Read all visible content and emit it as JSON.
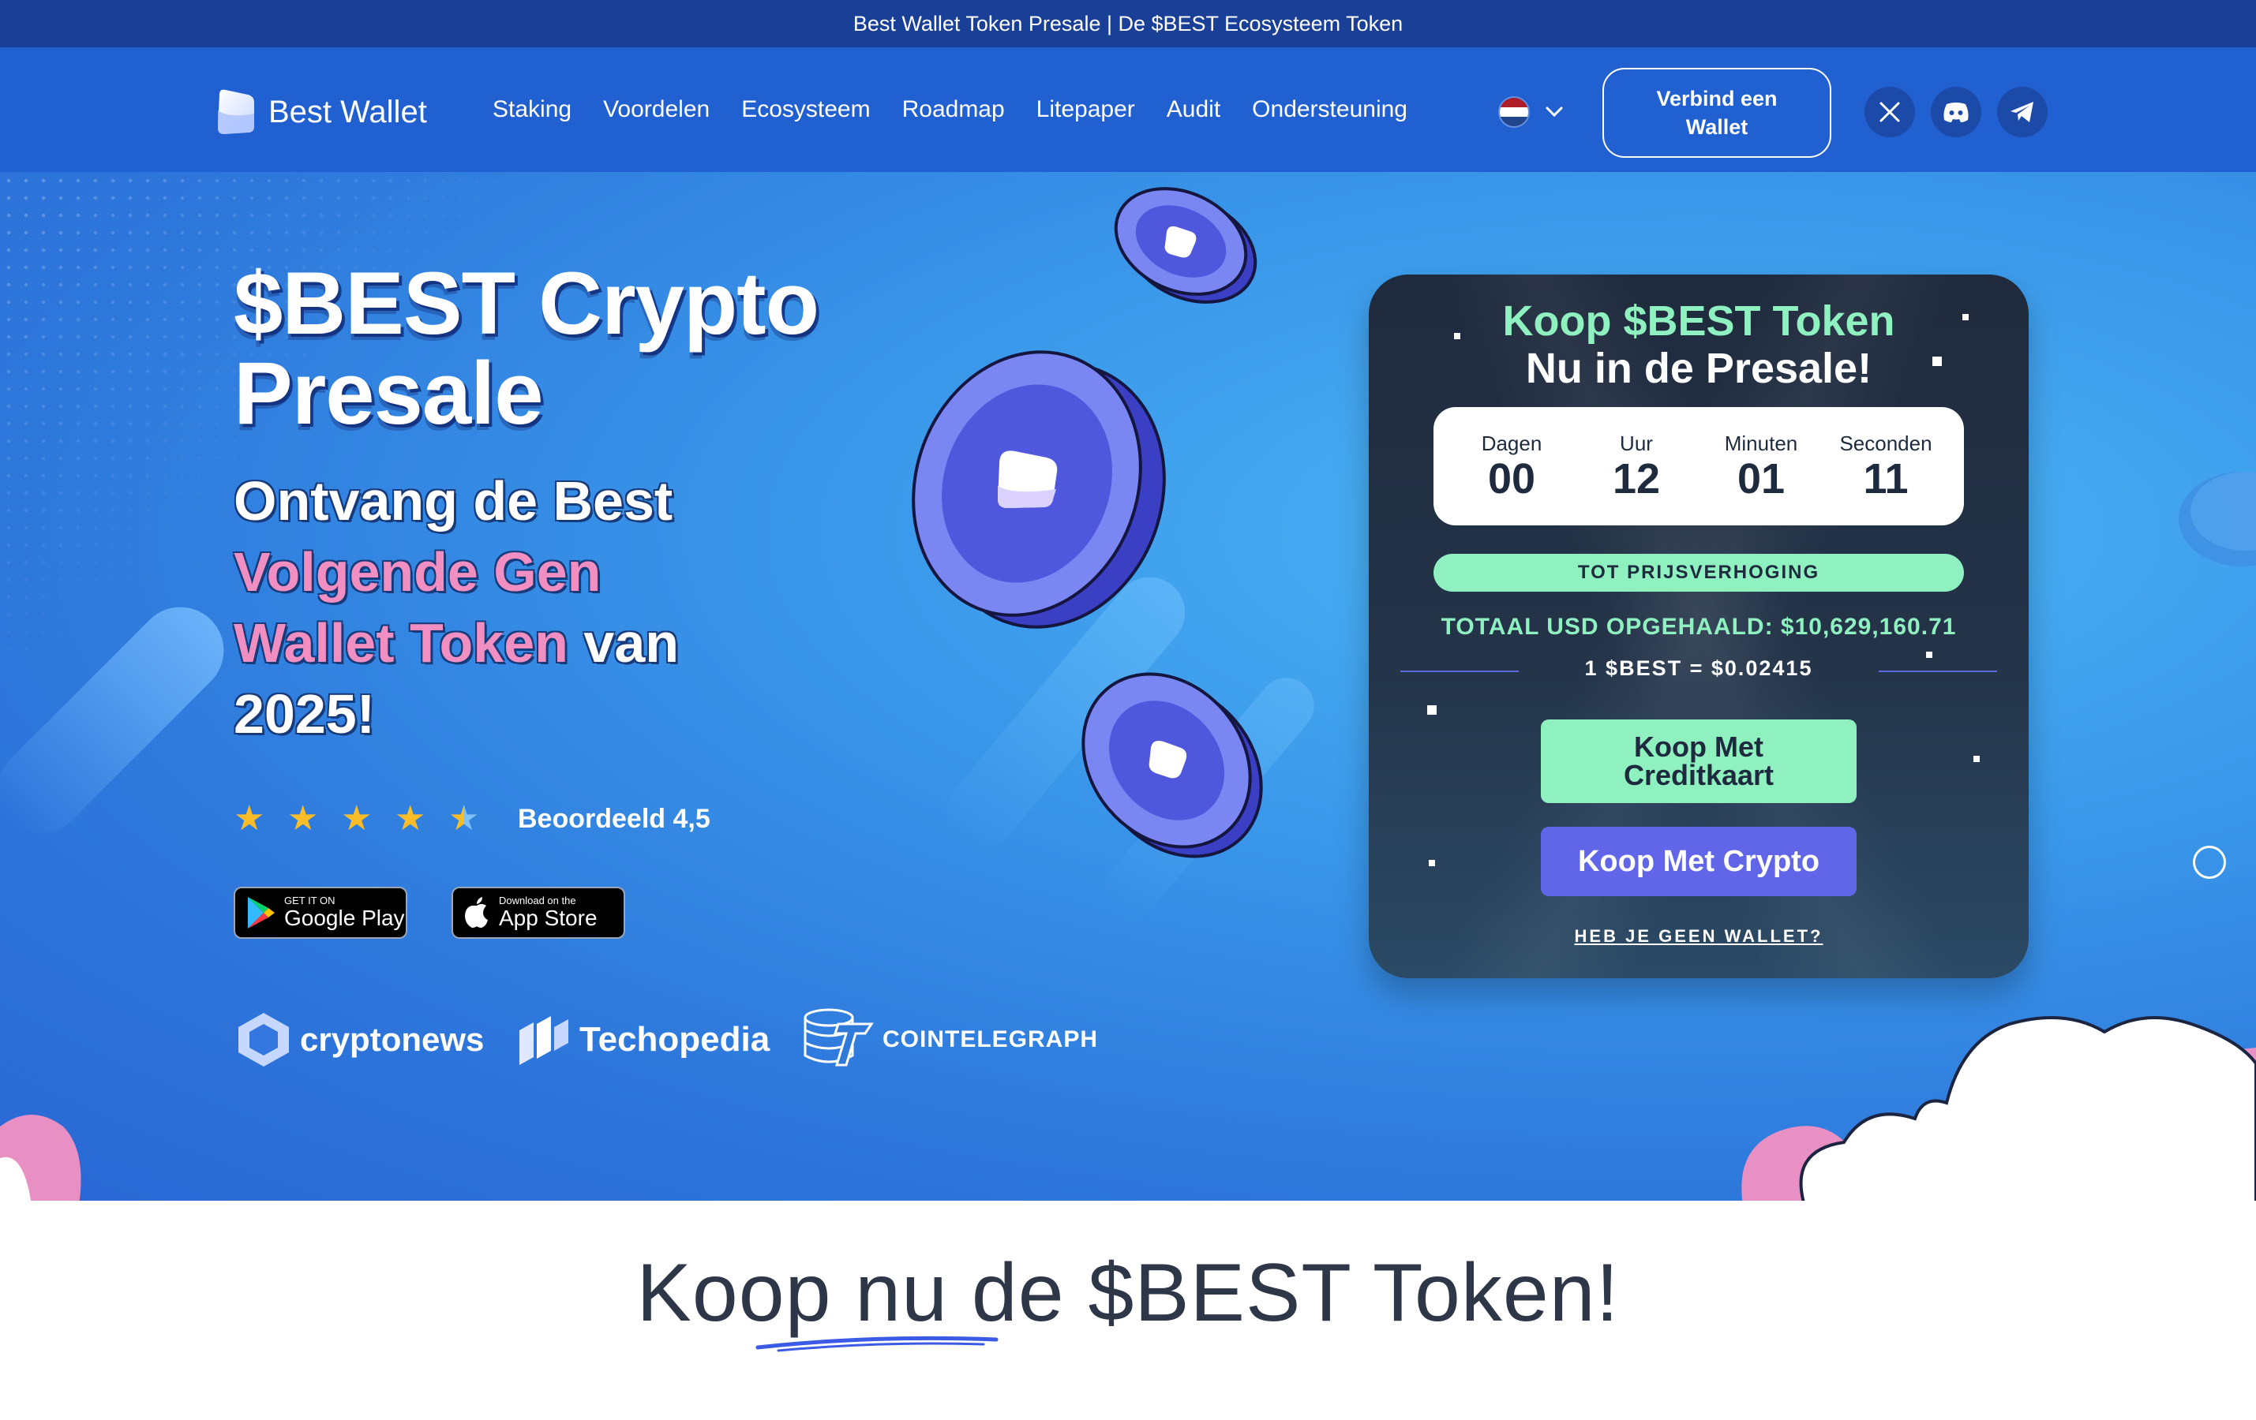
{
  "announcement": "Best Wallet Token Presale | De $BEST Ecosysteem Token",
  "brand": {
    "name": "Best Wallet"
  },
  "nav": {
    "items": [
      {
        "label": "Staking"
      },
      {
        "label": "Voordelen"
      },
      {
        "label": "Ecosysteem"
      },
      {
        "label": "Roadmap"
      },
      {
        "label": "Litepaper"
      },
      {
        "label": "Audit"
      },
      {
        "label": "Ondersteuning"
      }
    ],
    "language_flag": "netherlands-flag",
    "connect_label": "Verbind een Wallet",
    "socials": [
      "x-icon",
      "discord-icon",
      "telegram-icon"
    ]
  },
  "hero": {
    "title": "$BEST Crypto Presale",
    "subtitle_line1": "Ontvang de Best",
    "subtitle_pink1": "Volgende Gen",
    "subtitle_pink2": "Wallet Token",
    "subtitle_rest": "van",
    "subtitle_year": "2025!",
    "rating_value": 4.5,
    "rating_label": "Beoordeeld 4,5",
    "stores": {
      "google": {
        "small": "GET IT ON",
        "big": "Google Play"
      },
      "apple": {
        "small": "Download on the",
        "big": "App Store"
      }
    },
    "press": [
      "cryptonews",
      "Techopedia",
      "COINTELEGRAPH"
    ]
  },
  "presale": {
    "title_line1": "Koop $BEST Token",
    "title_line2": "Nu in de Presale!",
    "countdown": [
      {
        "label": "Dagen",
        "value": "00"
      },
      {
        "label": "Uur",
        "value": "12"
      },
      {
        "label": "Minuten",
        "value": "01"
      },
      {
        "label": "Seconden",
        "value": "11"
      }
    ],
    "price_increase_label": "TOT PRIJSVERHOGING",
    "raised": "TOTAAL USD OPGEHAALD: $10,629,160.71",
    "rate": "1 $BEST = $0.02415",
    "buy_card_label": "Koop Met Creditkaart",
    "buy_crypto_label": "Koop Met Crypto",
    "no_wallet_label": "HEB JE GEEN WALLET?"
  },
  "section": {
    "title": "Koop nu de $BEST Token!"
  },
  "colors": {
    "announce_bg": "#1a3f96",
    "nav_bg": "#2160d0",
    "mint": "#8ff0c0",
    "purple": "#6166e8",
    "pink": "#f28fc2",
    "card_bg": "#1f2a3d"
  }
}
